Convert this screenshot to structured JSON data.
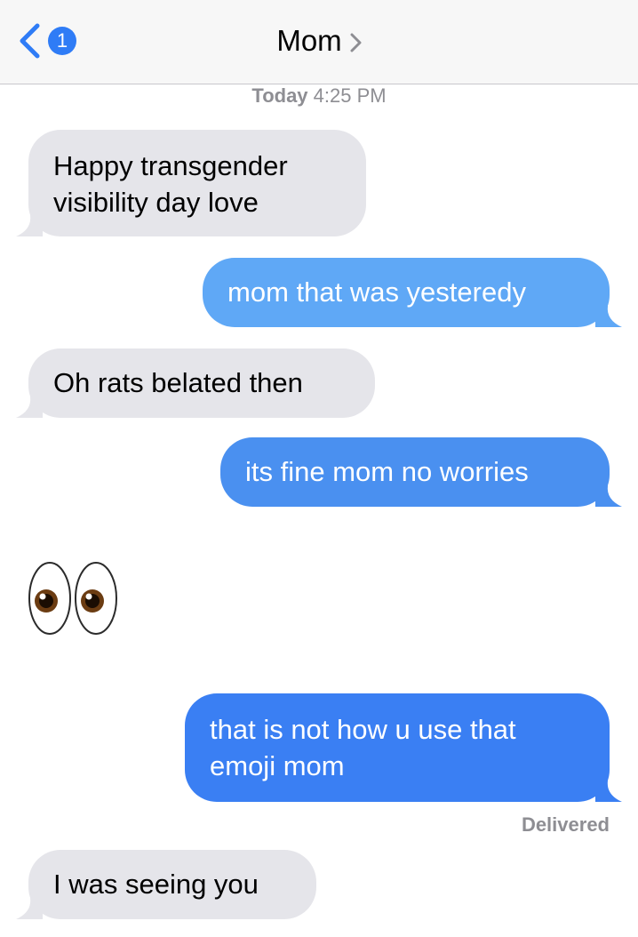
{
  "header": {
    "back_badge": "1",
    "contact_name": "Mom"
  },
  "timestamp": {
    "day": "Today",
    "time": "4:25 PM"
  },
  "messages": [
    {
      "direction": "incoming",
      "lines": [
        "Happy transgender",
        "visibility day love"
      ]
    },
    {
      "direction": "outgoing",
      "lines": [
        "mom that was yesteredy"
      ]
    },
    {
      "direction": "incoming",
      "lines": [
        "Oh rats belated then"
      ]
    },
    {
      "direction": "outgoing",
      "lines": [
        "its fine mom no worries"
      ]
    },
    {
      "direction": "incoming",
      "emoji": "eyes-emoji"
    },
    {
      "direction": "outgoing",
      "lines": [
        "that is not how u use that",
        "emoji mom"
      ]
    },
    {
      "direction": "incoming",
      "lines": [
        "I was seeing you"
      ]
    }
  ],
  "delivery_status": "Delivered",
  "colors": {
    "incoming_bubble": "#e5e5ea",
    "outgoing_bubble": "#3a7ff3",
    "accent": "#2f7cf6"
  },
  "icons": [
    "back-chevron-icon",
    "contact-chevron-icon",
    "eyes-emoji"
  ]
}
